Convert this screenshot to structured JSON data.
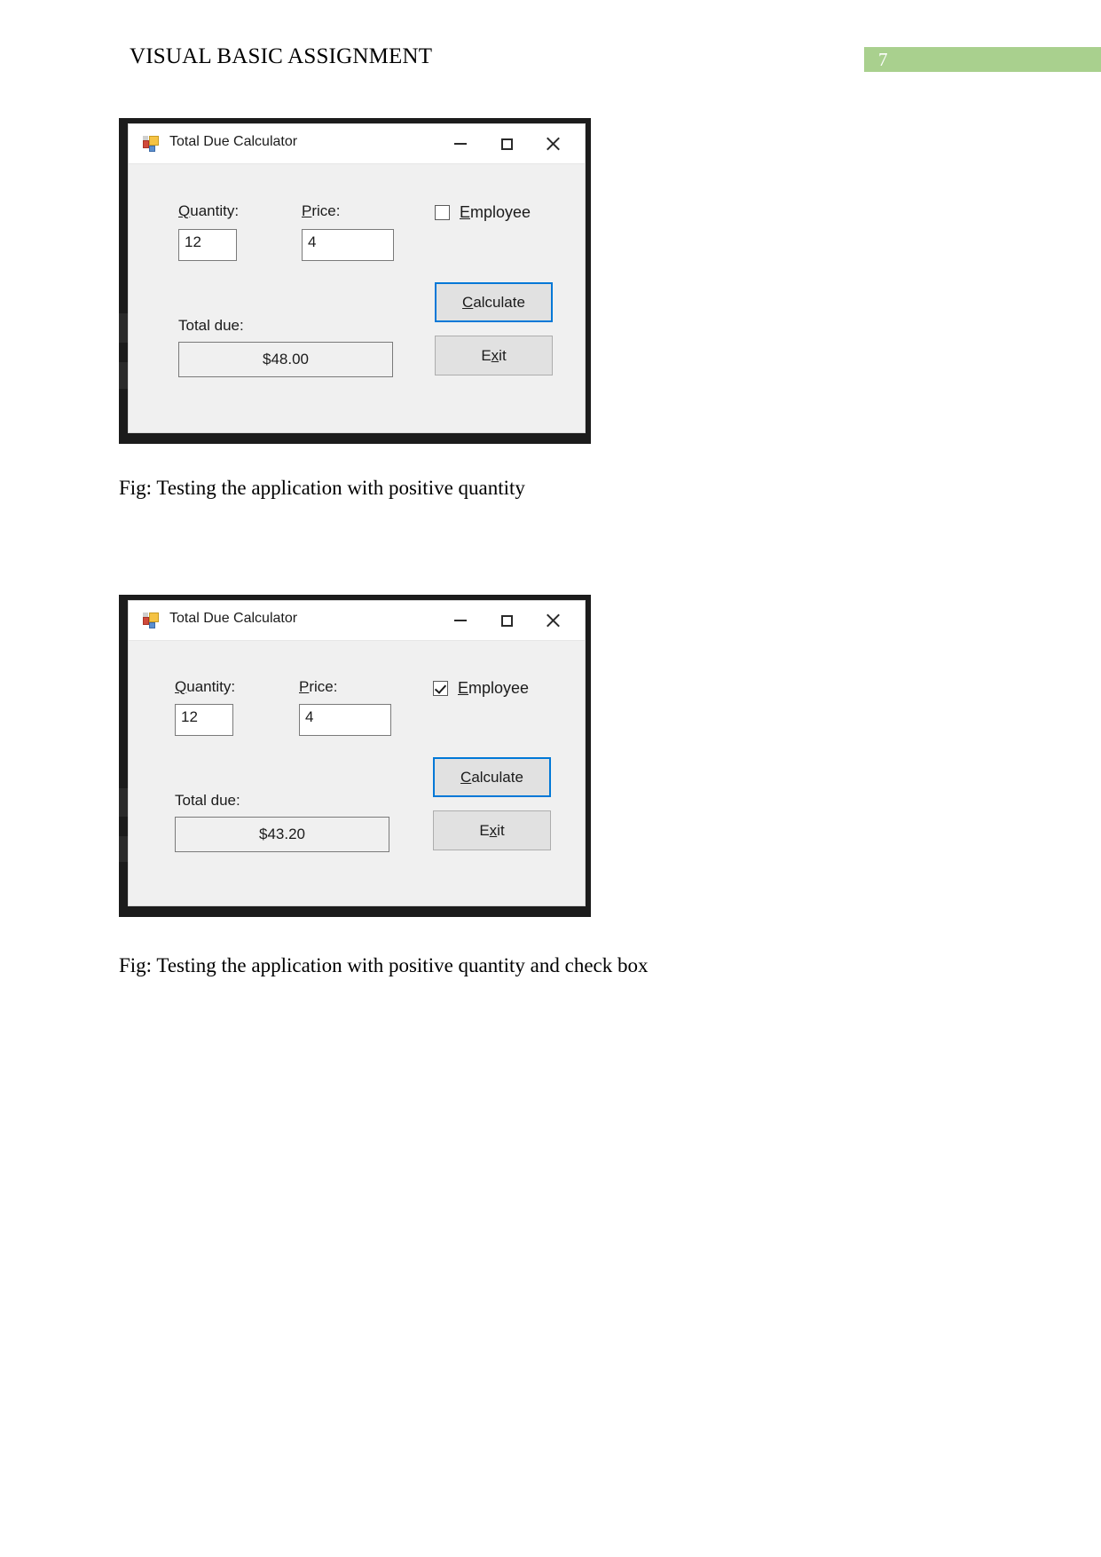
{
  "header": {
    "title": "VISUAL BASIC ASSIGNMENT",
    "page_number": "7",
    "badge_color": "#a9d08e"
  },
  "figures": [
    {
      "window": {
        "title": "Total Due Calculator",
        "icon": "vb-form-icon",
        "controls": {
          "minimize": "minimize-icon",
          "maximize": "maximize-icon",
          "close": "close-icon"
        },
        "quantity_label": "Quantity:",
        "quantity_accel": "Q",
        "quantity_rest": "uantity:",
        "quantity_value": "12",
        "price_label": "Price:",
        "price_accel": "P",
        "price_rest": "rice:",
        "price_value": "4",
        "employee_accel": "E",
        "employee_rest": "mployee",
        "employee_checked": false,
        "total_label": "Total due:",
        "total_value": "$48.00",
        "calculate_pre": "C",
        "calculate_rest": "alculate",
        "calculate_focused": true,
        "exit_pre": "E",
        "exit_accel": "x",
        "exit_rest": "it"
      },
      "caption": "Fig: Testing the application with positive quantity"
    },
    {
      "window": {
        "title": "Total Due Calculator",
        "icon": "vb-form-icon",
        "controls": {
          "minimize": "minimize-icon",
          "maximize": "maximize-icon",
          "close": "close-icon"
        },
        "quantity_label": "Quantity:",
        "quantity_accel": "Q",
        "quantity_rest": "uantity:",
        "quantity_value": "12",
        "price_label": "Price:",
        "price_accel": "P",
        "price_rest": "rice:",
        "price_value": "4",
        "employee_accel": "E",
        "employee_rest": "mployee",
        "employee_checked": true,
        "total_label": "Total due:",
        "total_value": "$43.20",
        "calculate_pre": "C",
        "calculate_rest": "alculate",
        "calculate_focused": true,
        "exit_pre": "E",
        "exit_accel": "x",
        "exit_rest": "it"
      },
      "caption": "Fig: Testing the application with positive quantity and check box"
    }
  ]
}
